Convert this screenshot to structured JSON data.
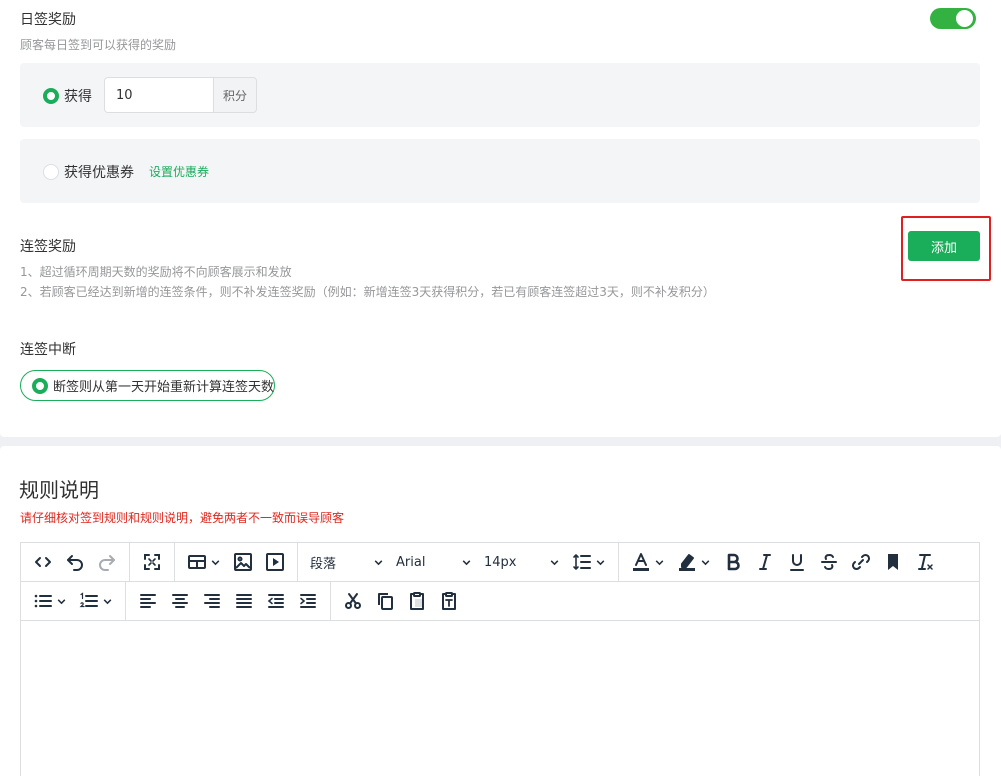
{
  "daily": {
    "title": "日签奖励",
    "subtitle": "顾客每日签到可以获得的奖励",
    "enabled": true,
    "points_option": {
      "label": "获得",
      "value": "10",
      "unit": "积分",
      "selected": true
    },
    "coupon_option": {
      "label": "获得优惠券",
      "link": "设置优惠券",
      "selected": false
    }
  },
  "streak": {
    "title": "连签奖励",
    "notes": [
      "1、超过循环周期天数的奖励将不向顾客展示和发放",
      "2、若顾客已经达到新增的连签条件，则不补发连签奖励（例如：新增连签3天获得积分，若已有顾客连签超过3天，则不补发积分）"
    ],
    "add_label": "添加"
  },
  "break_rule": {
    "title": "连签中断",
    "option": "断签则从第一天开始重新计算连签天数"
  },
  "rules": {
    "title": "规则说明",
    "warning": "请仔细核对签到规则和规则说明，避免两者不一致而误导顾客"
  },
  "editor": {
    "block_format": "段落",
    "font_family": "Arial",
    "font_size": "14px"
  },
  "colors": {
    "brand_green": "#1aad5a",
    "toggle_green": "#34b241",
    "warning_red": "#e0281e",
    "highlight_box": "#e02020"
  }
}
